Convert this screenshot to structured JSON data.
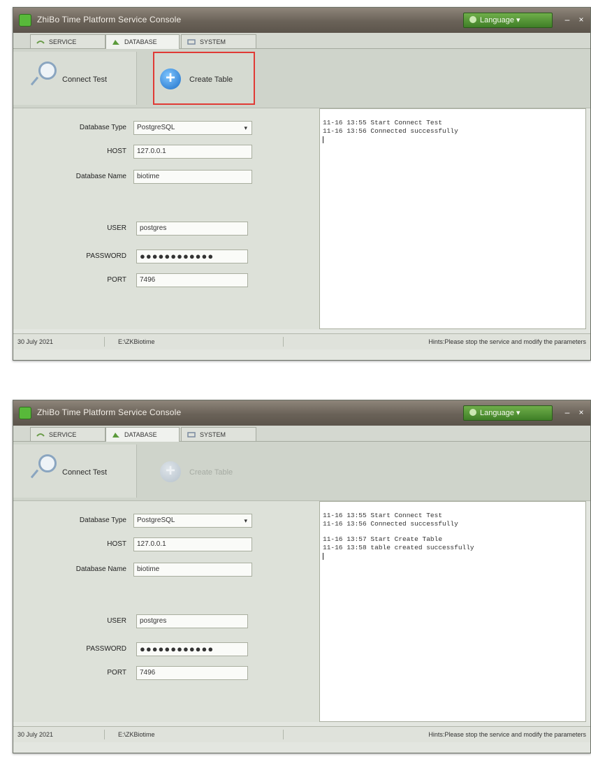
{
  "windows": [
    {
      "title": "ZhiBo Time Platform Service Console",
      "language_button": "Language",
      "tabs": [
        "SERVICE",
        "DATABASE",
        "SYSTEM"
      ],
      "toolbar": {
        "connect_label": "Connect Test",
        "create_label": "Create Table"
      },
      "form": {
        "db_type_label": "Database Type",
        "db_type_value": "PostgreSQL",
        "host_label": "HOST",
        "host_value": "127.0.0.1",
        "db_name_label": "Database Name",
        "db_name_value": "biotime",
        "user_label": "USER",
        "user_value": "postgres",
        "password_label": "PASSWORD",
        "password_value": "●●●●●●●●●●●●",
        "port_label": "PORT",
        "port_value": "7496"
      },
      "log": [
        "11-16 13:55 Start Connect Test",
        "11-16 13:56 Connected successfully"
      ],
      "status": {
        "date": "30 July 2021",
        "path": "E:\\ZKBiotime",
        "hint": "Hints:Please stop the service and modify the parameters"
      }
    },
    {
      "title": "ZhiBo Time Platform Service Console",
      "language_button": "Language",
      "tabs": [
        "SERVICE",
        "DATABASE",
        "SYSTEM"
      ],
      "toolbar": {
        "connect_label": "Connect Test",
        "create_label": "Create Table"
      },
      "form": {
        "db_type_label": "Database Type",
        "db_type_value": "PostgreSQL",
        "host_label": "HOST",
        "host_value": "127.0.0.1",
        "db_name_label": "Database Name",
        "db_name_value": "biotime",
        "user_label": "USER",
        "user_value": "postgres",
        "password_label": "PASSWORD",
        "password_value": "●●●●●●●●●●●●",
        "port_label": "PORT",
        "port_value": "7496"
      },
      "log": [
        "11-16 13:55 Start Connect Test",
        "11-16 13:56 Connected successfully",
        "",
        "11-16 13:57 Start Create Table",
        "11-16 13:58 table created successfully"
      ],
      "status": {
        "date": "30 July 2021",
        "path": "E:\\ZKBiotime",
        "hint": "Hints:Please stop the service and modify the parameters"
      }
    }
  ]
}
